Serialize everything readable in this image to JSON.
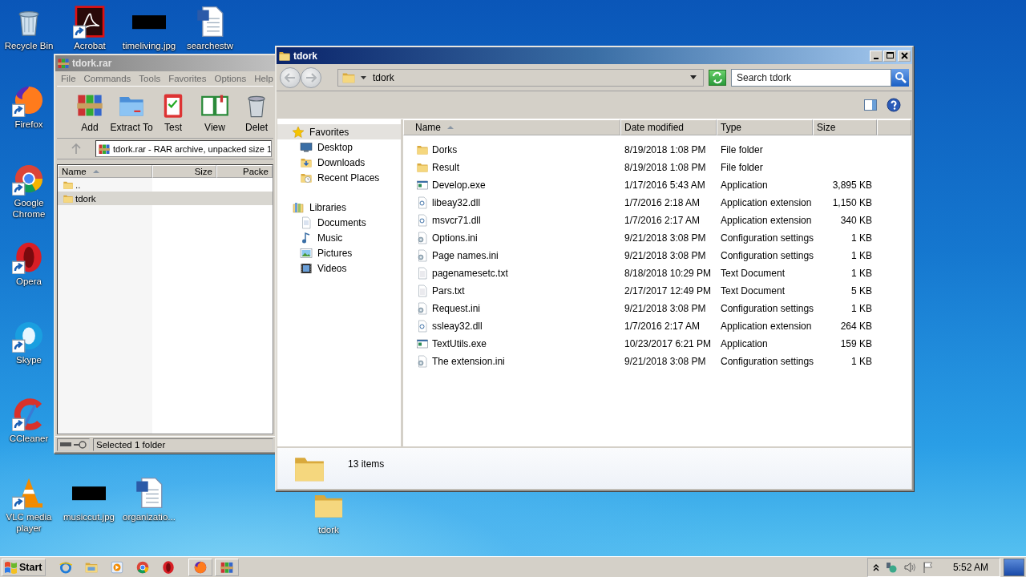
{
  "desktop": {
    "icons": [
      {
        "label": "Recycle Bin",
        "kind": "recycle",
        "shortcut": false
      },
      {
        "label": "Acrobat",
        "kind": "acrobat",
        "shortcut": true
      },
      {
        "label": "timeliving.jpg",
        "kind": "image",
        "shortcut": false
      },
      {
        "label": "searchestw",
        "kind": "word",
        "shortcut": false
      },
      {
        "label": "Firefox",
        "kind": "firefox",
        "shortcut": true
      },
      {
        "label": "Google Chrome",
        "kind": "chrome",
        "shortcut": true
      },
      {
        "label": "Opera",
        "kind": "opera",
        "shortcut": true
      },
      {
        "label": "Skype",
        "kind": "skype",
        "shortcut": true
      },
      {
        "label": "CCleaner",
        "kind": "ccleaner",
        "shortcut": true
      },
      {
        "label": "VLC media player",
        "kind": "vlc",
        "shortcut": true
      },
      {
        "label": "musiccut.jpg",
        "kind": "image",
        "shortcut": false
      },
      {
        "label": "organizatio...",
        "kind": "word",
        "shortcut": false
      },
      {
        "label": "tdork",
        "kind": "folder",
        "shortcut": false
      }
    ]
  },
  "winrar": {
    "title": "tdork.rar",
    "menu": [
      "File",
      "Commands",
      "Tools",
      "Favorites",
      "Options",
      "Help"
    ],
    "toolbar": [
      {
        "label": "Add",
        "kind": "add"
      },
      {
        "label": "Extract To",
        "kind": "extract"
      },
      {
        "label": "Test",
        "kind": "test"
      },
      {
        "label": "View",
        "kind": "view"
      },
      {
        "label": "Delet",
        "kind": "delete"
      }
    ],
    "address": "tdork.rar - RAR archive, unpacked size 1",
    "columns": [
      {
        "label": "Name",
        "sorted": true
      },
      {
        "label": "Size",
        "sorted": false
      },
      {
        "label": "Packe",
        "sorted": false
      }
    ],
    "rows": [
      {
        "name": "..",
        "selected": false
      },
      {
        "name": "tdork",
        "selected": true
      }
    ],
    "status": "Selected 1 folder"
  },
  "explorer": {
    "title": "tdork",
    "breadcrumb": "tdork",
    "search": {
      "placeholder": "Search tdork"
    },
    "navigation": [
      {
        "label": "Favorites",
        "kind": "favorites",
        "selected": true,
        "children": [
          {
            "label": "Desktop",
            "kind": "desktop",
            "selected": false
          },
          {
            "label": "Downloads",
            "kind": "downloads",
            "selected": false
          },
          {
            "label": "Recent Places",
            "kind": "recent",
            "selected": false
          }
        ]
      },
      {
        "label": "Libraries",
        "kind": "libraries",
        "selected": false,
        "children": [
          {
            "label": "Documents",
            "kind": "documents",
            "selected": false
          },
          {
            "label": "Music",
            "kind": "music",
            "selected": false
          },
          {
            "label": "Pictures",
            "kind": "pictures",
            "selected": false
          },
          {
            "label": "Videos",
            "kind": "videos",
            "selected": false
          }
        ]
      }
    ],
    "columns": [
      {
        "label": "Name",
        "sorted": true
      },
      {
        "label": "Date modified",
        "sorted": false
      },
      {
        "label": "Type",
        "sorted": false
      },
      {
        "label": "Size",
        "sorted": false
      }
    ],
    "files": [
      {
        "name": "Dorks",
        "date": "8/19/2018 1:08 PM",
        "type": "File folder",
        "kind": "folder",
        "selected": false
      },
      {
        "name": "Result",
        "date": "8/19/2018 1:08 PM",
        "type": "File folder",
        "kind": "folder",
        "selected": false
      },
      {
        "name": "Develop.exe",
        "date": "1/17/2016 5:43 AM",
        "type": "Application",
        "size": "3,895 KB",
        "kind": "exe",
        "selected": false
      },
      {
        "name": "libeay32.dll",
        "date": "1/7/2016 2:18 AM",
        "type": "Application extension",
        "size": "1,150 KB",
        "kind": "dll",
        "selected": false
      },
      {
        "name": "msvcr71.dll",
        "date": "1/7/2016 2:17 AM",
        "type": "Application extension",
        "size": "340 KB",
        "kind": "dll",
        "selected": false
      },
      {
        "name": "Options.ini",
        "date": "9/21/2018 3:08 PM",
        "type": "Configuration settings",
        "size": "1 KB",
        "kind": "ini",
        "selected": false
      },
      {
        "name": "Page names.ini",
        "date": "9/21/2018 3:08 PM",
        "type": "Configuration settings",
        "size": "1 KB",
        "kind": "ini",
        "selected": false
      },
      {
        "name": "pagenamesetc.txt",
        "date": "8/18/2018 10:29 PM",
        "type": "Text Document",
        "size": "1 KB",
        "kind": "txt",
        "selected": false
      },
      {
        "name": "Pars.txt",
        "date": "2/17/2017 12:49 PM",
        "type": "Text Document",
        "size": "5 KB",
        "kind": "txt",
        "selected": false
      },
      {
        "name": "Request.ini",
        "date": "9/21/2018 3:08 PM",
        "type": "Configuration settings",
        "size": "1 KB",
        "kind": "ini",
        "selected": false
      },
      {
        "name": "ssleay32.dll",
        "date": "1/7/2016 2:17 AM",
        "type": "Application extension",
        "size": "264 KB",
        "kind": "dll",
        "selected": false
      },
      {
        "name": "TextUtils.exe",
        "date": "10/23/2017 6:21 PM",
        "type": "Application",
        "size": "159 KB",
        "kind": "exe",
        "selected": false
      },
      {
        "name": "The extension.ini",
        "date": "9/21/2018 3:08 PM",
        "type": "Configuration settings",
        "size": "1 KB",
        "kind": "ini",
        "selected": false
      }
    ],
    "summary": "13 items"
  },
  "taskbar": {
    "start": "Start",
    "quick_launch": [
      {
        "kind": "ie"
      },
      {
        "kind": "explorer"
      },
      {
        "kind": "media"
      },
      {
        "kind": "chrome"
      },
      {
        "kind": "opera"
      }
    ],
    "tasks": [
      {
        "kind": "firefox"
      },
      {
        "kind": "winrar"
      }
    ],
    "tray": [
      {
        "kind": "network"
      },
      {
        "kind": "volume"
      },
      {
        "kind": "flag"
      }
    ],
    "clock": "5:52 AM"
  }
}
